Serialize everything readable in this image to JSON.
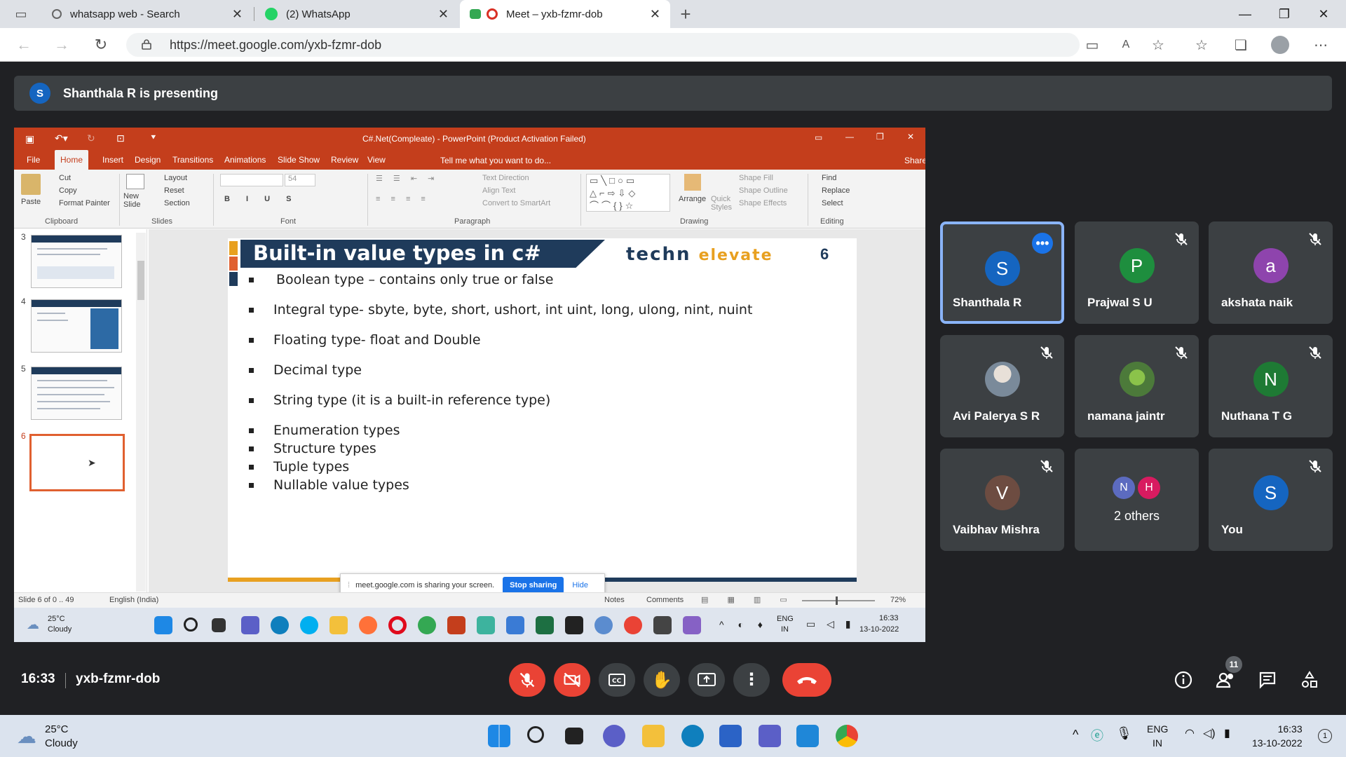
{
  "browser": {
    "tabs": [
      {
        "title": "whatsapp web - Search"
      },
      {
        "title": "(2) WhatsApp"
      },
      {
        "title": "Meet – yxb-fzmr-dob"
      }
    ],
    "url": "https://meet.google.com/yxb-fzmr-dob"
  },
  "banner": {
    "avatar_letter": "S",
    "text": "Shanthala R is presenting"
  },
  "powerpoint": {
    "window_title": "C#.Net(Compleate) - PowerPoint (Product Activation Failed)",
    "ribbon_tabs": [
      "File",
      "Home",
      "Insert",
      "Design",
      "Transitions",
      "Animations",
      "Slide Show",
      "Review",
      "View"
    ],
    "tell_me": "Tell me what you want to do...",
    "share": "Share",
    "clipboard": {
      "paste": "Paste",
      "cut": "Cut",
      "copy": "Copy",
      "format_painter": "Format Painter",
      "group": "Clipboard"
    },
    "slides_group": {
      "new_slide": "New Slide",
      "layout": "Layout",
      "reset": "Reset",
      "section": "Section",
      "group": "Slides"
    },
    "font_group": {
      "size": "54",
      "group": "Font"
    },
    "paragraph_group": {
      "text_direction": "Text Direction",
      "align_text": "Align Text",
      "convert": "Convert to SmartArt",
      "group": "Paragraph"
    },
    "drawing_group": {
      "arrange": "Arrange",
      "quick_styles": "Quick Styles",
      "shape_fill": "Shape Fill",
      "shape_outline": "Shape Outline",
      "shape_effects": "Shape Effects",
      "group": "Drawing"
    },
    "editing_group": {
      "find": "Find",
      "replace": "Replace",
      "select": "Select",
      "group": "Editing"
    },
    "thumbnail_numbers": [
      "3",
      "4",
      "5",
      "6"
    ],
    "slide": {
      "title": "Built-in value types in c#",
      "logo_a": "techn",
      "logo_b": "elevate",
      "number": "6",
      "bullets": [
        "Boolean type – contains only true or false",
        "Integral type- sbyte, byte, short, ushort, int uint, long, ulong, nint, nuint",
        "Floating type- float and Double",
        "Decimal type",
        "String type (it is a built-in reference type)",
        "Enumeration types",
        "Structure types",
        "Tuple types",
        "Nullable value types"
      ]
    },
    "sharing_notice": {
      "text": "meet.google.com is sharing your screen.",
      "stop": "Stop sharing",
      "hide": "Hide"
    },
    "status": {
      "slide_info": "Slide 6 of 0 .. 49",
      "language": "English (India)",
      "notes": "Notes",
      "comments": "Comments",
      "zoom": "72%"
    },
    "inner_taskbar": {
      "temp": "25°C",
      "condition": "Cloudy",
      "lang": "ENG",
      "region": "IN",
      "time": "16:33",
      "date": "13-10-2022"
    }
  },
  "participants": [
    {
      "name": "Shanthala R",
      "letter": "S",
      "color": "#1565c0",
      "speaking": true
    },
    {
      "name": "Prajwal S U",
      "letter": "P",
      "color": "#1e8e3e"
    },
    {
      "name": "akshata naik",
      "letter": "a",
      "color": "#8e44ad"
    },
    {
      "name": "Avi Palerya S R",
      "letter": "",
      "color": "#7a8a9a"
    },
    {
      "name": "namana jaintr",
      "letter": "",
      "color": "#4c7a3a"
    },
    {
      "name": "Nuthana T G",
      "letter": "N",
      "color": "#1e7a34"
    },
    {
      "name": "Vaibhav Mishra",
      "letter": "V",
      "color": "#6d4c41"
    },
    {
      "name": "2 others",
      "letters": [
        "N",
        "H"
      ],
      "colors": [
        "#5c6bc0",
        "#d81b60"
      ]
    },
    {
      "name": "You",
      "letter": "S",
      "color": "#1565c0"
    }
  ],
  "meeting": {
    "time": "16:33",
    "code": "yxb-fzmr-dob",
    "people_count": "11"
  },
  "system_taskbar": {
    "temp": "25°C",
    "condition": "Cloudy",
    "lang": "ENG",
    "region": "IN",
    "time": "16:33",
    "date": "13-10-2022",
    "notifications": "1"
  },
  "colors": {
    "accent_blue": "#1a73e8",
    "end_call_red": "#ea4335",
    "ppt_orange": "#c43e1c",
    "slide_navy": "#1f3b5b"
  }
}
